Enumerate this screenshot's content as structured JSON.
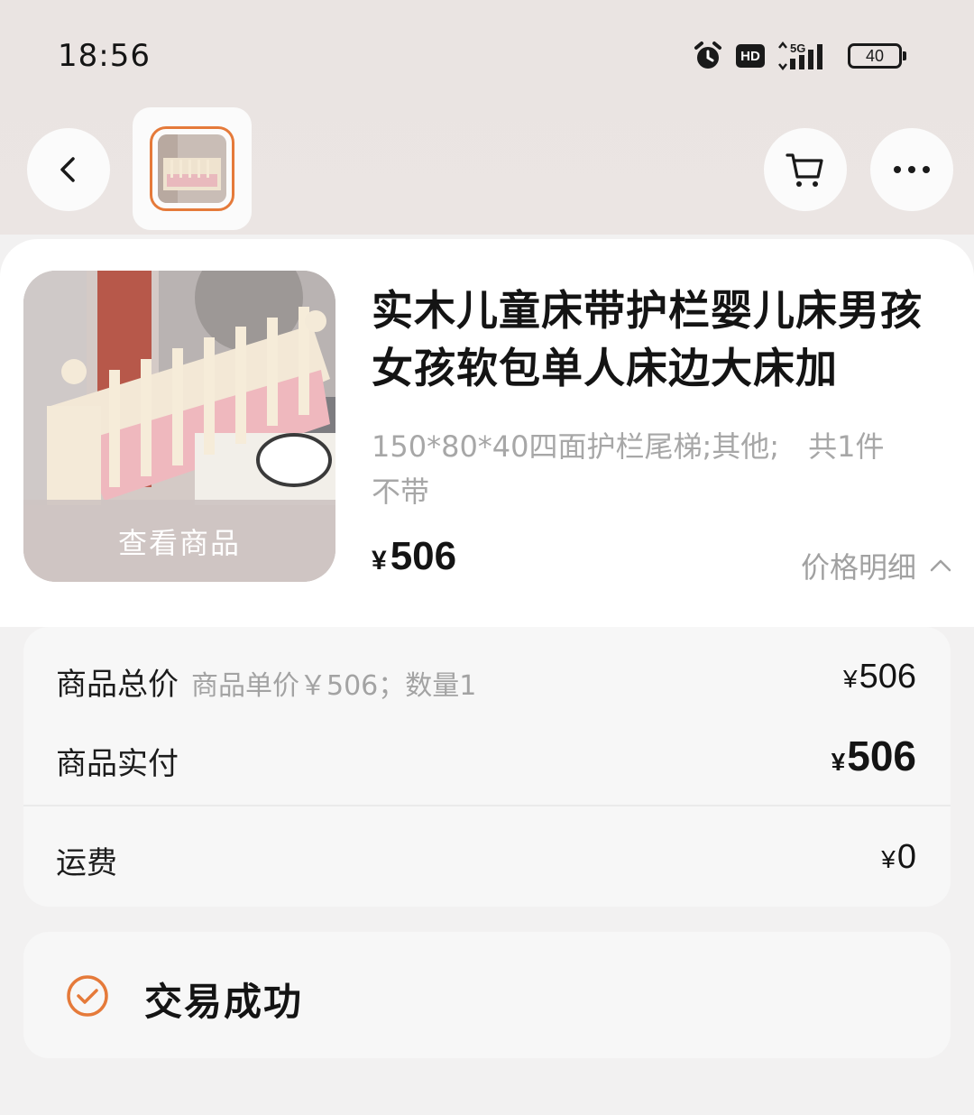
{
  "status_bar": {
    "time": "18:56",
    "hd": "HD",
    "network": "5G",
    "battery": "40"
  },
  "nav": {
    "back_icon": "chevron-left-icon",
    "cart_icon": "shopping-cart-icon",
    "more_icon": "more-dots-icon",
    "accent_color": "#e57a3a"
  },
  "product": {
    "title": "实木儿童床带护栏婴儿床男孩女孩软包单人床边大床加",
    "spec": "150*80*40四面护栏尾梯;其他;　共1件",
    "spec_line2": "不带",
    "view_label": "查看商品",
    "price_symbol": "¥",
    "price_value": "506",
    "price_detail_label": "价格明细"
  },
  "breakdown": {
    "total_label": "商品总价",
    "total_sub": "商品单价￥506；数量1",
    "total_value": "506",
    "paid_label": "商品实付",
    "paid_value": "506",
    "shipping_label": "运费",
    "shipping_value": "0",
    "yen": "¥"
  },
  "order_status": {
    "text": "交易成功",
    "icon": "check-circle-icon"
  }
}
